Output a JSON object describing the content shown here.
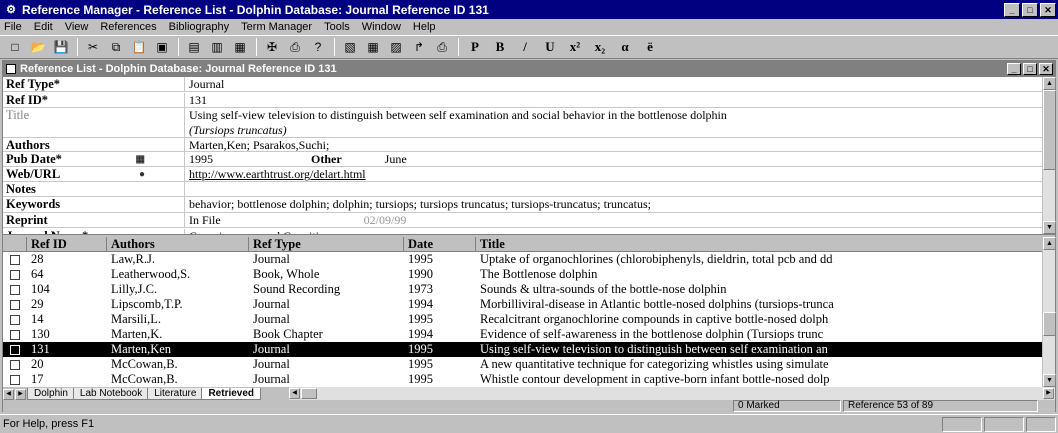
{
  "window": {
    "title": "Reference Manager - Reference List - Dolphin Database: Journal Reference ID 131",
    "controls": [
      "_",
      "□",
      "✕"
    ]
  },
  "menu": [
    {
      "label": "File"
    },
    {
      "label": "Edit"
    },
    {
      "label": "View"
    },
    {
      "label": "References"
    },
    {
      "label": "Bibliography"
    },
    {
      "label": "Term Manager"
    },
    {
      "label": "Tools"
    },
    {
      "label": "Window"
    },
    {
      "label": "Help"
    }
  ],
  "toolbar": {
    "icons": [
      "new-icon",
      "open-icon",
      "save-icon",
      "cut-icon",
      "copy-icon",
      "paste-icon",
      "find-icon",
      "list-icon",
      "insert-icon",
      "edit-icon",
      "spell-icon",
      "print-icon",
      "help-icon",
      "column-icon",
      "grid-icon",
      "preview-icon",
      "export-icon",
      "import-icon"
    ],
    "glyphs": [
      "□",
      "📂",
      "💾",
      "✂",
      "⧉",
      "📋",
      "▣",
      "▤",
      "▥",
      "▦",
      "✠",
      "⎙",
      "?",
      "▧",
      "▦",
      "▨",
      "↱",
      "⎙"
    ],
    "format": [
      "P",
      "B",
      "/",
      "U",
      "x²",
      "x₂",
      "α",
      "ë"
    ]
  },
  "child_window": {
    "title": "Reference List - Dolphin Database: Journal Reference ID 131"
  },
  "record": {
    "ref_type_label": "Ref Type*",
    "ref_type": "Journal",
    "ref_id_label": "Ref ID*",
    "ref_id": "131",
    "title_label": "Title",
    "title_line1": "Using self-view television to distinguish between self examination and social behavior in the bottlenose dolphin",
    "title_line2": "(Tursiops truncatus)",
    "authors_label": "Authors",
    "authors": "Marten,Ken; Psarakos,Suchi;",
    "pub_date_label": "Pub Date*",
    "pub_date": "1995",
    "other_label": "Other",
    "other": "June",
    "web_url_label": "Web/URL",
    "web_url": "http://www.earthtrust.org/delart.html",
    "notes_label": "Notes",
    "notes": "",
    "keywords_label": "Keywords",
    "keywords": "behavior; bottlenose dolphin; dolphin; tursiops; tursiops truncatus; tursiops-truncatus; truncatus;",
    "reprint_label": "Reprint",
    "reprint": "In File",
    "reprint_date": "02/09/99",
    "journal_label": "Journal Name*",
    "journal": "Consciousness and Cognition"
  },
  "grid": {
    "headers": [
      "Ref ID",
      "Authors",
      "Ref Type",
      "Date",
      "Title"
    ],
    "rows": [
      {
        "id": "28",
        "author": "Law,R.J.",
        "type": "Journal",
        "date": "1995",
        "title": "Uptake of organochlorines (chlorobiphenyls, dieldrin, total pcb and dd",
        "selected": false
      },
      {
        "id": "64",
        "author": "Leatherwood,S.",
        "type": "Book, Whole",
        "date": "1990",
        "title": "The Bottlenose dolphin",
        "selected": false
      },
      {
        "id": "104",
        "author": "Lilly,J.C.",
        "type": "Sound Recording",
        "date": "1973",
        "title": "Sounds & ultra-sounds of the bottle-nose dolphin",
        "selected": false
      },
      {
        "id": "29",
        "author": "Lipscomb,T.P.",
        "type": "Journal",
        "date": "1994",
        "title": "Morbilliviral-disease in Atlantic bottle-nosed dolphins (tursiops-trunca",
        "selected": false
      },
      {
        "id": "14",
        "author": "Marsili,L.",
        "type": "Journal",
        "date": "1995",
        "title": "Recalcitrant organochlorine compounds in captive bottle-nosed dolph",
        "selected": false
      },
      {
        "id": "130",
        "author": "Marten,K.",
        "type": "Book Chapter",
        "date": "1994",
        "title": "Evidence of self-awareness in the bottlenose dolphin (Tursiops trunc",
        "selected": false
      },
      {
        "id": "131",
        "author": "Marten,Ken",
        "type": "Journal",
        "date": "1995",
        "title": "Using self-view television to distinguish between self examination an",
        "selected": true
      },
      {
        "id": "20",
        "author": "McCowan,B.",
        "type": "Journal",
        "date": "1995",
        "title": "A new quantitative technique for categorizing whistles using simulate",
        "selected": false
      },
      {
        "id": "17",
        "author": "McCowan,B.",
        "type": "Journal",
        "date": "1995",
        "title": "Whistle contour development in captive-born infant bottle-nosed dolp",
        "selected": false
      }
    ]
  },
  "tabs": [
    {
      "label": "Dolphin",
      "active": false
    },
    {
      "label": "Lab Notebook",
      "active": false
    },
    {
      "label": "Literature",
      "active": false
    },
    {
      "label": "Retrieved",
      "active": true
    }
  ],
  "info": {
    "marked": "0 Marked",
    "position": "Reference 53 of 89"
  },
  "status": {
    "text": "For Help, press F1"
  }
}
